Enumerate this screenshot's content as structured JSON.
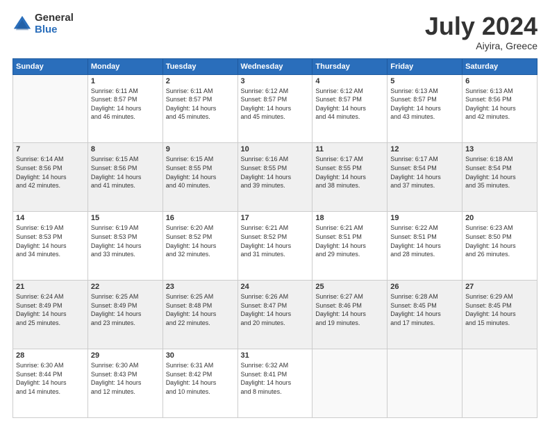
{
  "logo": {
    "general": "General",
    "blue": "Blue"
  },
  "header": {
    "month": "July 2024",
    "location": "Aiyira, Greece"
  },
  "weekdays": [
    "Sunday",
    "Monday",
    "Tuesday",
    "Wednesday",
    "Thursday",
    "Friday",
    "Saturday"
  ],
  "weeks": [
    [
      {
        "day": "",
        "info": ""
      },
      {
        "day": "1",
        "info": "Sunrise: 6:11 AM\nSunset: 8:57 PM\nDaylight: 14 hours\nand 46 minutes."
      },
      {
        "day": "2",
        "info": "Sunrise: 6:11 AM\nSunset: 8:57 PM\nDaylight: 14 hours\nand 45 minutes."
      },
      {
        "day": "3",
        "info": "Sunrise: 6:12 AM\nSunset: 8:57 PM\nDaylight: 14 hours\nand 45 minutes."
      },
      {
        "day": "4",
        "info": "Sunrise: 6:12 AM\nSunset: 8:57 PM\nDaylight: 14 hours\nand 44 minutes."
      },
      {
        "day": "5",
        "info": "Sunrise: 6:13 AM\nSunset: 8:57 PM\nDaylight: 14 hours\nand 43 minutes."
      },
      {
        "day": "6",
        "info": "Sunrise: 6:13 AM\nSunset: 8:56 PM\nDaylight: 14 hours\nand 42 minutes."
      }
    ],
    [
      {
        "day": "7",
        "info": "Sunrise: 6:14 AM\nSunset: 8:56 PM\nDaylight: 14 hours\nand 42 minutes."
      },
      {
        "day": "8",
        "info": "Sunrise: 6:15 AM\nSunset: 8:56 PM\nDaylight: 14 hours\nand 41 minutes."
      },
      {
        "day": "9",
        "info": "Sunrise: 6:15 AM\nSunset: 8:55 PM\nDaylight: 14 hours\nand 40 minutes."
      },
      {
        "day": "10",
        "info": "Sunrise: 6:16 AM\nSunset: 8:55 PM\nDaylight: 14 hours\nand 39 minutes."
      },
      {
        "day": "11",
        "info": "Sunrise: 6:17 AM\nSunset: 8:55 PM\nDaylight: 14 hours\nand 38 minutes."
      },
      {
        "day": "12",
        "info": "Sunrise: 6:17 AM\nSunset: 8:54 PM\nDaylight: 14 hours\nand 37 minutes."
      },
      {
        "day": "13",
        "info": "Sunrise: 6:18 AM\nSunset: 8:54 PM\nDaylight: 14 hours\nand 35 minutes."
      }
    ],
    [
      {
        "day": "14",
        "info": "Sunrise: 6:19 AM\nSunset: 8:53 PM\nDaylight: 14 hours\nand 34 minutes."
      },
      {
        "day": "15",
        "info": "Sunrise: 6:19 AM\nSunset: 8:53 PM\nDaylight: 14 hours\nand 33 minutes."
      },
      {
        "day": "16",
        "info": "Sunrise: 6:20 AM\nSunset: 8:52 PM\nDaylight: 14 hours\nand 32 minutes."
      },
      {
        "day": "17",
        "info": "Sunrise: 6:21 AM\nSunset: 8:52 PM\nDaylight: 14 hours\nand 31 minutes."
      },
      {
        "day": "18",
        "info": "Sunrise: 6:21 AM\nSunset: 8:51 PM\nDaylight: 14 hours\nand 29 minutes."
      },
      {
        "day": "19",
        "info": "Sunrise: 6:22 AM\nSunset: 8:51 PM\nDaylight: 14 hours\nand 28 minutes."
      },
      {
        "day": "20",
        "info": "Sunrise: 6:23 AM\nSunset: 8:50 PM\nDaylight: 14 hours\nand 26 minutes."
      }
    ],
    [
      {
        "day": "21",
        "info": "Sunrise: 6:24 AM\nSunset: 8:49 PM\nDaylight: 14 hours\nand 25 minutes."
      },
      {
        "day": "22",
        "info": "Sunrise: 6:25 AM\nSunset: 8:49 PM\nDaylight: 14 hours\nand 23 minutes."
      },
      {
        "day": "23",
        "info": "Sunrise: 6:25 AM\nSunset: 8:48 PM\nDaylight: 14 hours\nand 22 minutes."
      },
      {
        "day": "24",
        "info": "Sunrise: 6:26 AM\nSunset: 8:47 PM\nDaylight: 14 hours\nand 20 minutes."
      },
      {
        "day": "25",
        "info": "Sunrise: 6:27 AM\nSunset: 8:46 PM\nDaylight: 14 hours\nand 19 minutes."
      },
      {
        "day": "26",
        "info": "Sunrise: 6:28 AM\nSunset: 8:45 PM\nDaylight: 14 hours\nand 17 minutes."
      },
      {
        "day": "27",
        "info": "Sunrise: 6:29 AM\nSunset: 8:45 PM\nDaylight: 14 hours\nand 15 minutes."
      }
    ],
    [
      {
        "day": "28",
        "info": "Sunrise: 6:30 AM\nSunset: 8:44 PM\nDaylight: 14 hours\nand 14 minutes."
      },
      {
        "day": "29",
        "info": "Sunrise: 6:30 AM\nSunset: 8:43 PM\nDaylight: 14 hours\nand 12 minutes."
      },
      {
        "day": "30",
        "info": "Sunrise: 6:31 AM\nSunset: 8:42 PM\nDaylight: 14 hours\nand 10 minutes."
      },
      {
        "day": "31",
        "info": "Sunrise: 6:32 AM\nSunset: 8:41 PM\nDaylight: 14 hours\nand 8 minutes."
      },
      {
        "day": "",
        "info": ""
      },
      {
        "day": "",
        "info": ""
      },
      {
        "day": "",
        "info": ""
      }
    ]
  ]
}
